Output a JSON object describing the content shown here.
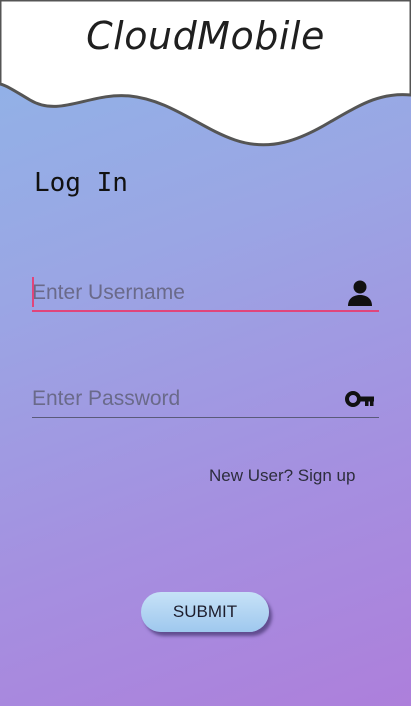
{
  "app": {
    "title": "CloudMobile"
  },
  "login": {
    "heading": "Log In"
  },
  "username": {
    "placeholder": "Enter Username",
    "value": "",
    "icon": "person-icon"
  },
  "password": {
    "placeholder": "Enter Password",
    "value": "",
    "icon": "key-icon"
  },
  "signup": {
    "label": "New User? Sign up"
  },
  "submit": {
    "label": "SUBMIT"
  },
  "colors": {
    "gradient_top": "#8fb5e8",
    "gradient_bottom": "#ad7fdb",
    "focus_underline": "#e0457b",
    "button_fill": "#b3d6f3"
  }
}
